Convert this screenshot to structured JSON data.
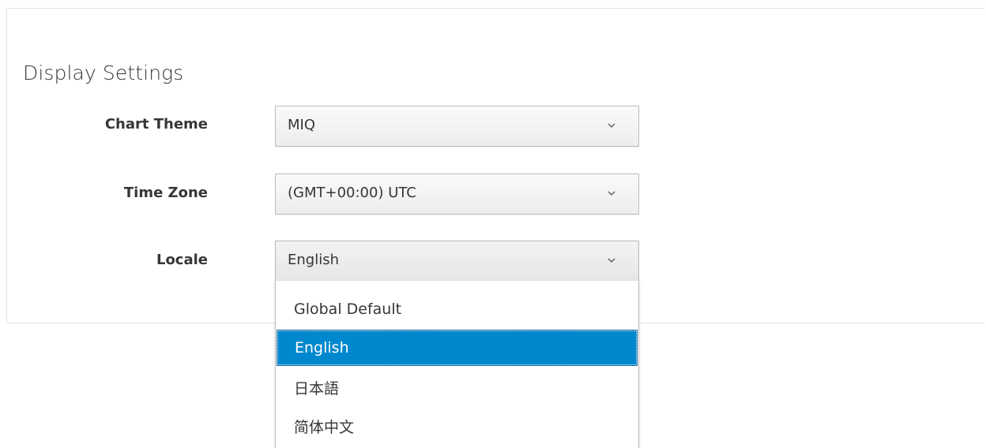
{
  "section": {
    "title": "Display Settings"
  },
  "fields": {
    "chart_theme": {
      "label": "Chart Theme",
      "value": "MIQ"
    },
    "time_zone": {
      "label": "Time Zone",
      "value": "(GMT+00:00) UTC"
    },
    "locale": {
      "label": "Locale",
      "value": "English",
      "options": [
        "Global Default",
        "English",
        "日本語",
        "简体中文"
      ],
      "highlighted_option": "English"
    }
  },
  "colors": {
    "highlight": "#0088ce",
    "text": "#363636",
    "border": "#bbbbbb"
  },
  "icons": {
    "select_chevron": "chevron-down-icon"
  }
}
